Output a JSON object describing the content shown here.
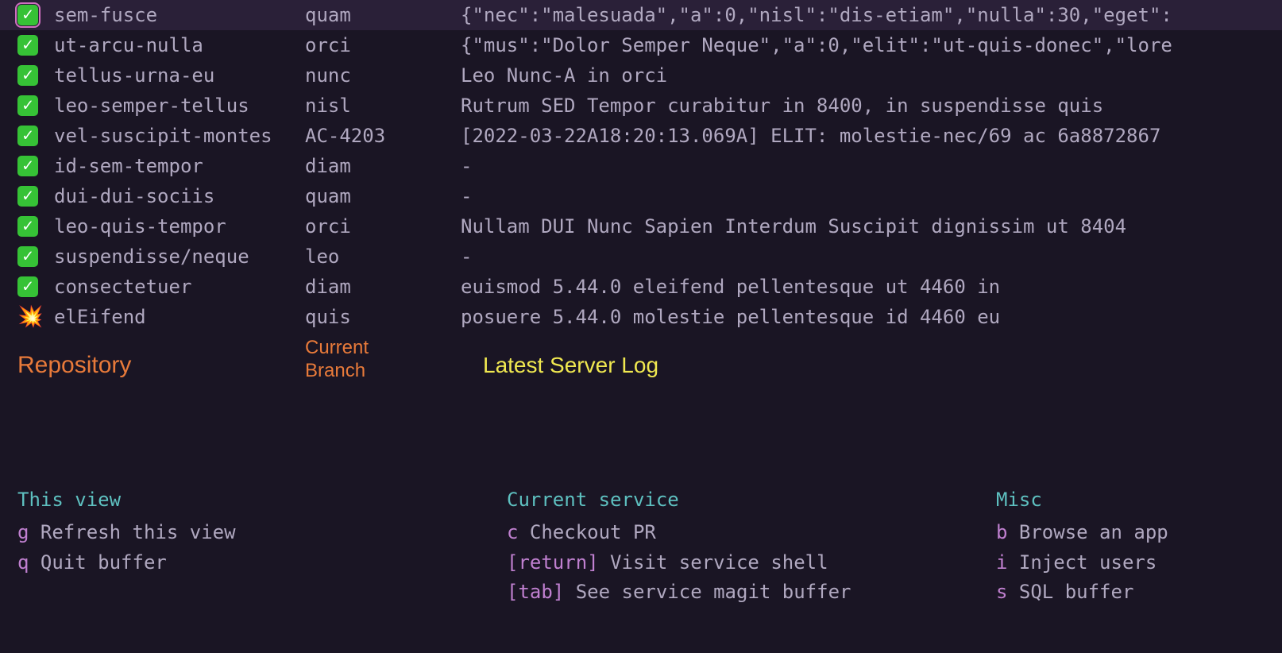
{
  "rows": [
    {
      "icon": "check",
      "selected": true,
      "repo": "sem-fusce",
      "branch": "quam",
      "log": "{\"nec\":\"malesuada\",\"a\":0,\"nisl\":\"dis-etiam\",\"nulla\":30,\"eget\":"
    },
    {
      "icon": "check",
      "selected": false,
      "repo": "ut-arcu-nulla",
      "branch": "orci",
      "log": "{\"mus\":\"Dolor Semper Neque\",\"a\":0,\"elit\":\"ut-quis-donec\",\"lore"
    },
    {
      "icon": "check",
      "selected": false,
      "repo": "tellus-urna-eu",
      "branch": "nunc",
      "log": "Leo Nunc-A in orci"
    },
    {
      "icon": "check",
      "selected": false,
      "repo": "leo-semper-tellus",
      "branch": "nisl",
      "log": "Rutrum SED Tempor curabitur in 8400, in suspendisse quis"
    },
    {
      "icon": "check",
      "selected": false,
      "repo": "vel-suscipit-montes",
      "branch": "AC-4203",
      "log": "[2022-03-22A18:20:13.069A]  ELIT: molestie-nec/69 ac 6a8872867"
    },
    {
      "icon": "check",
      "selected": false,
      "repo": "id-sem-tempor",
      "branch": "diam",
      "log": "-"
    },
    {
      "icon": "check",
      "selected": false,
      "repo": "dui-dui-sociis",
      "branch": "quam",
      "log": "-"
    },
    {
      "icon": "check",
      "selected": false,
      "repo": "leo-quis-tempor",
      "branch": "orci",
      "log": "Nullam DUI Nunc Sapien Interdum Suscipit dignissim ut 8404"
    },
    {
      "icon": "check",
      "selected": false,
      "repo": "suspendisse/neque",
      "branch": "leo",
      "log": "-"
    },
    {
      "icon": "check",
      "selected": false,
      "repo": "consectetuer",
      "branch": "diam",
      "log": "euismod 5.44.0 eleifend pellentesque ut 4460 in"
    },
    {
      "icon": "spark",
      "selected": false,
      "repo": "elEifend",
      "branch": "quis",
      "log": "posuere 5.44.0 molestie pellentesque id 4460 eu"
    }
  ],
  "headers": {
    "repository": "Repository",
    "branch_l1": "Current",
    "branch_l2": "Branch",
    "log": "Latest Server Log"
  },
  "help": {
    "view": {
      "title": "This view",
      "items": [
        {
          "key": "g",
          "label": "Refresh this view"
        },
        {
          "key": "q",
          "label": "Quit buffer"
        }
      ]
    },
    "service": {
      "title": "Current service",
      "items": [
        {
          "key": "c",
          "label": "Checkout PR"
        },
        {
          "key": "[return]",
          "label": "Visit service shell"
        },
        {
          "key": "[tab]",
          "label": "See service magit buffer"
        }
      ]
    },
    "misc": {
      "title": "Misc",
      "items": [
        {
          "key": "b",
          "label": "Browse an app"
        },
        {
          "key": "i",
          "label": "Inject users"
        },
        {
          "key": "s",
          "label": "SQL buffer"
        }
      ]
    }
  }
}
